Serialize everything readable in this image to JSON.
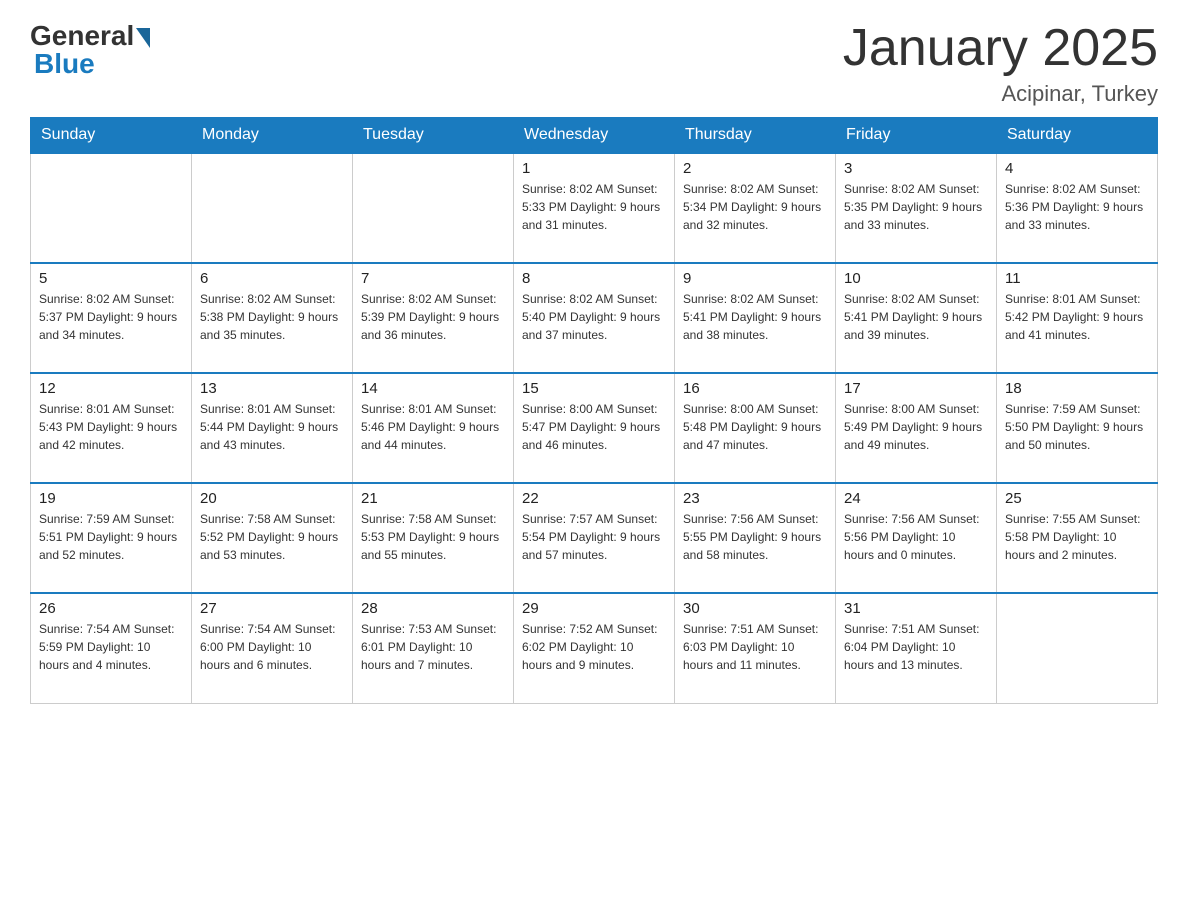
{
  "header": {
    "logo_general": "General",
    "logo_blue": "Blue",
    "title": "January 2025",
    "location": "Acipinar, Turkey"
  },
  "days_of_week": [
    "Sunday",
    "Monday",
    "Tuesday",
    "Wednesday",
    "Thursday",
    "Friday",
    "Saturday"
  ],
  "weeks": [
    [
      {
        "day": "",
        "info": ""
      },
      {
        "day": "",
        "info": ""
      },
      {
        "day": "",
        "info": ""
      },
      {
        "day": "1",
        "info": "Sunrise: 8:02 AM\nSunset: 5:33 PM\nDaylight: 9 hours\nand 31 minutes."
      },
      {
        "day": "2",
        "info": "Sunrise: 8:02 AM\nSunset: 5:34 PM\nDaylight: 9 hours\nand 32 minutes."
      },
      {
        "day": "3",
        "info": "Sunrise: 8:02 AM\nSunset: 5:35 PM\nDaylight: 9 hours\nand 33 minutes."
      },
      {
        "day": "4",
        "info": "Sunrise: 8:02 AM\nSunset: 5:36 PM\nDaylight: 9 hours\nand 33 minutes."
      }
    ],
    [
      {
        "day": "5",
        "info": "Sunrise: 8:02 AM\nSunset: 5:37 PM\nDaylight: 9 hours\nand 34 minutes."
      },
      {
        "day": "6",
        "info": "Sunrise: 8:02 AM\nSunset: 5:38 PM\nDaylight: 9 hours\nand 35 minutes."
      },
      {
        "day": "7",
        "info": "Sunrise: 8:02 AM\nSunset: 5:39 PM\nDaylight: 9 hours\nand 36 minutes."
      },
      {
        "day": "8",
        "info": "Sunrise: 8:02 AM\nSunset: 5:40 PM\nDaylight: 9 hours\nand 37 minutes."
      },
      {
        "day": "9",
        "info": "Sunrise: 8:02 AM\nSunset: 5:41 PM\nDaylight: 9 hours\nand 38 minutes."
      },
      {
        "day": "10",
        "info": "Sunrise: 8:02 AM\nSunset: 5:41 PM\nDaylight: 9 hours\nand 39 minutes."
      },
      {
        "day": "11",
        "info": "Sunrise: 8:01 AM\nSunset: 5:42 PM\nDaylight: 9 hours\nand 41 minutes."
      }
    ],
    [
      {
        "day": "12",
        "info": "Sunrise: 8:01 AM\nSunset: 5:43 PM\nDaylight: 9 hours\nand 42 minutes."
      },
      {
        "day": "13",
        "info": "Sunrise: 8:01 AM\nSunset: 5:44 PM\nDaylight: 9 hours\nand 43 minutes."
      },
      {
        "day": "14",
        "info": "Sunrise: 8:01 AM\nSunset: 5:46 PM\nDaylight: 9 hours\nand 44 minutes."
      },
      {
        "day": "15",
        "info": "Sunrise: 8:00 AM\nSunset: 5:47 PM\nDaylight: 9 hours\nand 46 minutes."
      },
      {
        "day": "16",
        "info": "Sunrise: 8:00 AM\nSunset: 5:48 PM\nDaylight: 9 hours\nand 47 minutes."
      },
      {
        "day": "17",
        "info": "Sunrise: 8:00 AM\nSunset: 5:49 PM\nDaylight: 9 hours\nand 49 minutes."
      },
      {
        "day": "18",
        "info": "Sunrise: 7:59 AM\nSunset: 5:50 PM\nDaylight: 9 hours\nand 50 minutes."
      }
    ],
    [
      {
        "day": "19",
        "info": "Sunrise: 7:59 AM\nSunset: 5:51 PM\nDaylight: 9 hours\nand 52 minutes."
      },
      {
        "day": "20",
        "info": "Sunrise: 7:58 AM\nSunset: 5:52 PM\nDaylight: 9 hours\nand 53 minutes."
      },
      {
        "day": "21",
        "info": "Sunrise: 7:58 AM\nSunset: 5:53 PM\nDaylight: 9 hours\nand 55 minutes."
      },
      {
        "day": "22",
        "info": "Sunrise: 7:57 AM\nSunset: 5:54 PM\nDaylight: 9 hours\nand 57 minutes."
      },
      {
        "day": "23",
        "info": "Sunrise: 7:56 AM\nSunset: 5:55 PM\nDaylight: 9 hours\nand 58 minutes."
      },
      {
        "day": "24",
        "info": "Sunrise: 7:56 AM\nSunset: 5:56 PM\nDaylight: 10 hours\nand 0 minutes."
      },
      {
        "day": "25",
        "info": "Sunrise: 7:55 AM\nSunset: 5:58 PM\nDaylight: 10 hours\nand 2 minutes."
      }
    ],
    [
      {
        "day": "26",
        "info": "Sunrise: 7:54 AM\nSunset: 5:59 PM\nDaylight: 10 hours\nand 4 minutes."
      },
      {
        "day": "27",
        "info": "Sunrise: 7:54 AM\nSunset: 6:00 PM\nDaylight: 10 hours\nand 6 minutes."
      },
      {
        "day": "28",
        "info": "Sunrise: 7:53 AM\nSunset: 6:01 PM\nDaylight: 10 hours\nand 7 minutes."
      },
      {
        "day": "29",
        "info": "Sunrise: 7:52 AM\nSunset: 6:02 PM\nDaylight: 10 hours\nand 9 minutes."
      },
      {
        "day": "30",
        "info": "Sunrise: 7:51 AM\nSunset: 6:03 PM\nDaylight: 10 hours\nand 11 minutes."
      },
      {
        "day": "31",
        "info": "Sunrise: 7:51 AM\nSunset: 6:04 PM\nDaylight: 10 hours\nand 13 minutes."
      },
      {
        "day": "",
        "info": ""
      }
    ]
  ]
}
